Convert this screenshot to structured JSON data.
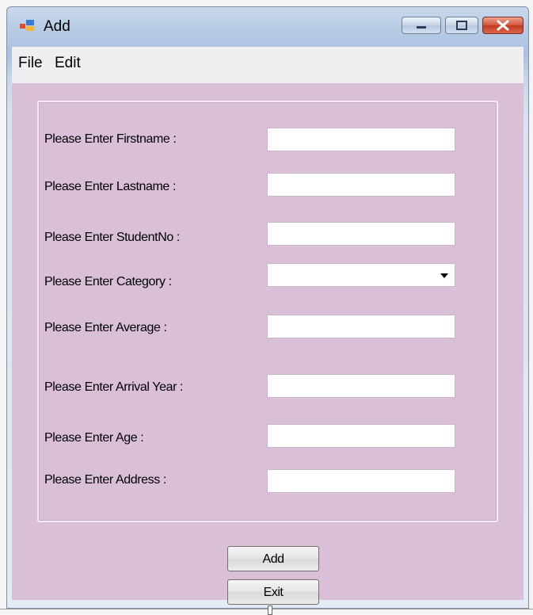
{
  "window": {
    "title": "Add",
    "icon": "windows-form-icon"
  },
  "menu": {
    "items": [
      {
        "label": "File"
      },
      {
        "label": "Edit"
      }
    ]
  },
  "form": {
    "fields": [
      {
        "label": "Please Enter Firstname :",
        "value": ""
      },
      {
        "label": "Please Enter Lastname :",
        "value": ""
      },
      {
        "label": "Please Enter StudentNo :",
        "value": ""
      },
      {
        "label": "Please Enter Category :",
        "value": "",
        "type": "dropdown"
      },
      {
        "label": "Please Enter Average :",
        "value": ""
      },
      {
        "label": "Please Enter Arrival Year :",
        "value": ""
      },
      {
        "label": "Please Enter Age :",
        "value": ""
      },
      {
        "label": "Please Enter Address :",
        "value": ""
      }
    ]
  },
  "buttons": {
    "add_label": "Add",
    "exit_label": "Exit"
  },
  "colors": {
    "client_background": "#d9bfd8",
    "field_background": "#ffffff"
  }
}
